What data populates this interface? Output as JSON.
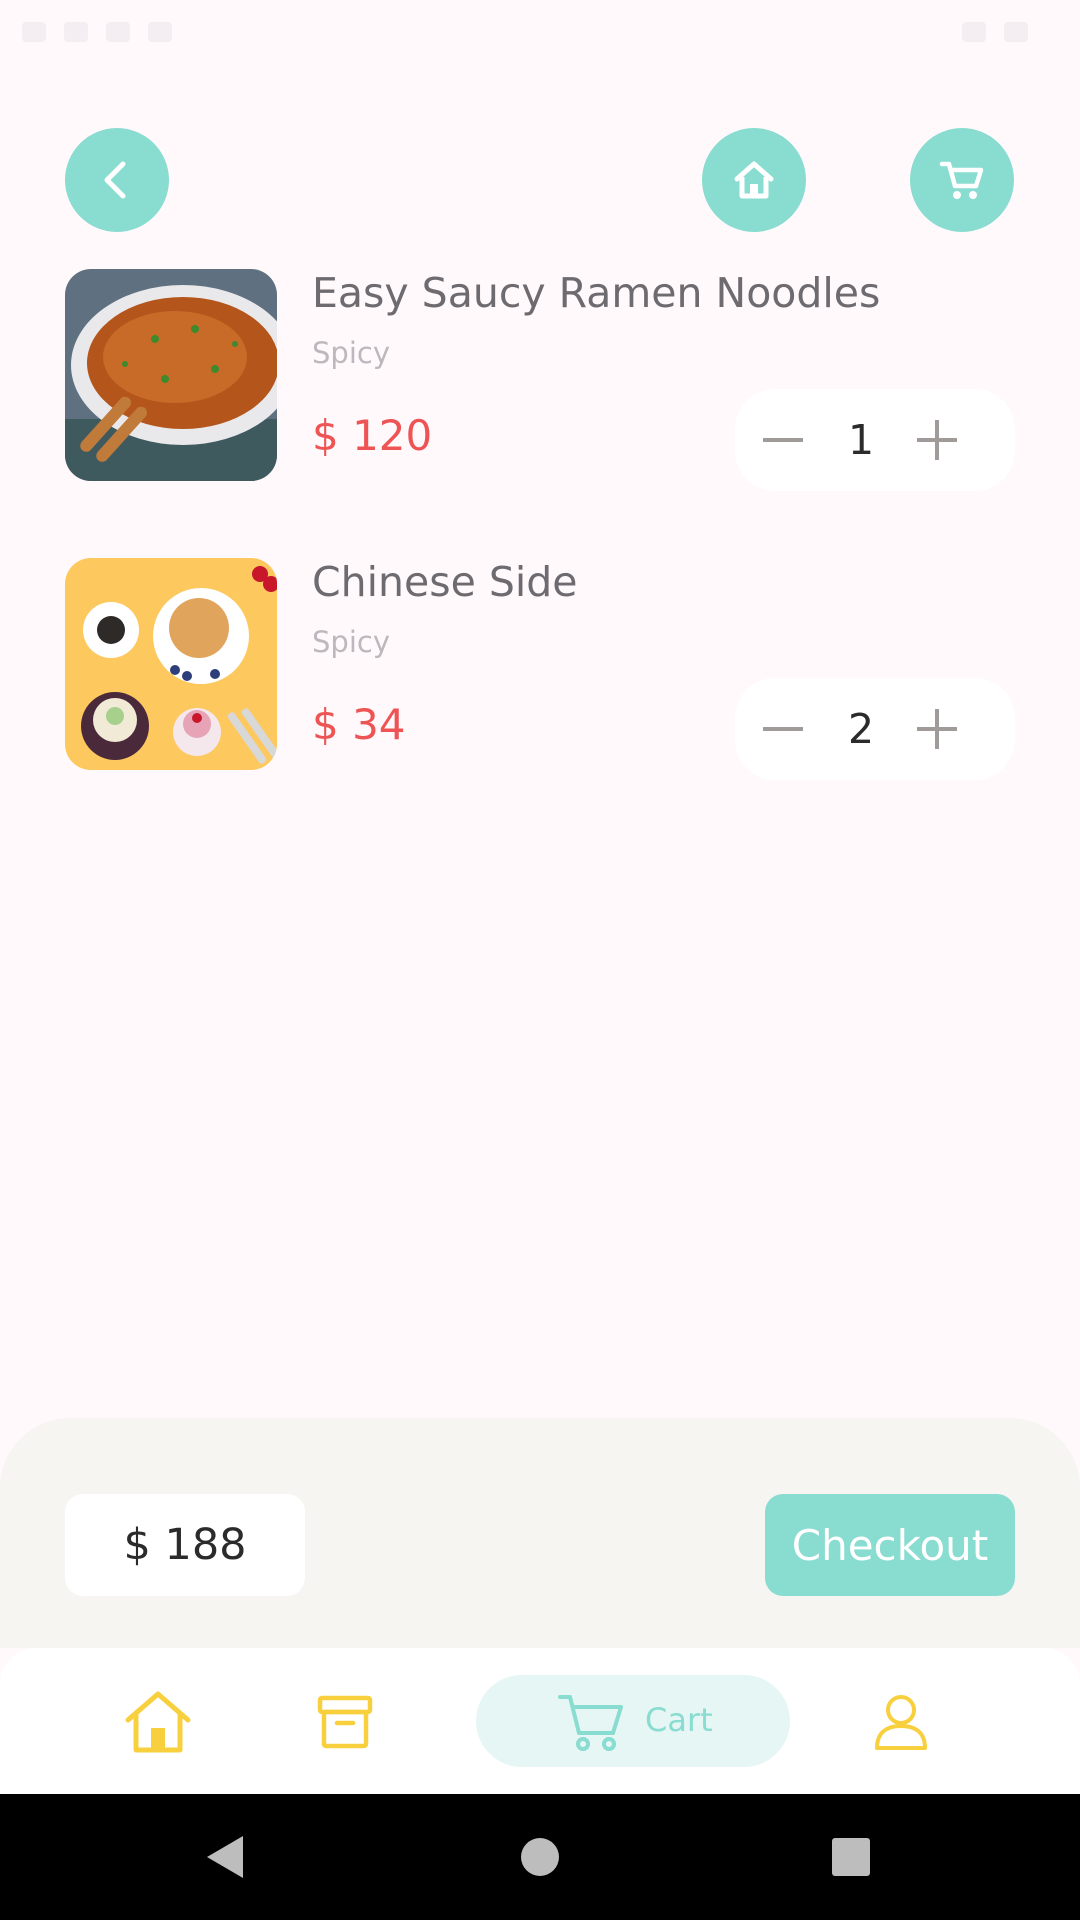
{
  "header": {
    "back_icon": "chevron-left-icon",
    "home_icon": "home-icon",
    "cart_icon": "cart-icon",
    "accent_color": "#89DCD0"
  },
  "cart": {
    "items": [
      {
        "name": "Easy Saucy Ramen Noodles",
        "subtitle": "Spicy",
        "price": "$ 120",
        "quantity": "1"
      },
      {
        "name": "Chinese Side",
        "subtitle": "Spicy",
        "price": "$ 34",
        "quantity": "2"
      }
    ],
    "price_color": "#EE5454"
  },
  "summary": {
    "total": "$ 188",
    "checkout_label": "Checkout"
  },
  "tab_bar": {
    "tabs": [
      {
        "icon": "home-icon",
        "label": ""
      },
      {
        "icon": "archive-icon",
        "label": ""
      },
      {
        "icon": "cart-icon",
        "label": "Cart"
      },
      {
        "icon": "user-icon",
        "label": ""
      }
    ],
    "active_tab": "Cart",
    "icon_color": "#F8D03E"
  },
  "system_nav": {
    "icons": [
      "back-triangle-icon",
      "home-circle-icon",
      "recents-square-icon"
    ]
  }
}
